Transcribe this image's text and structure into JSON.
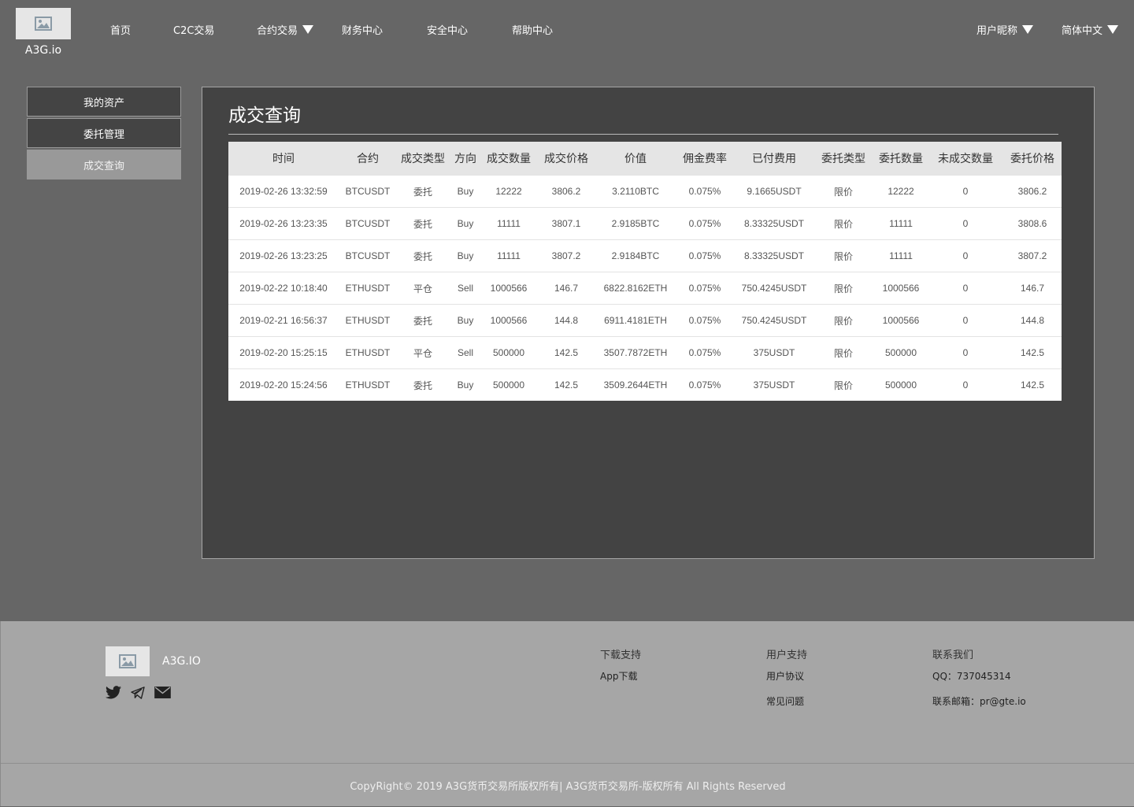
{
  "header": {
    "brand": "A3G.io",
    "nav": [
      "首页",
      "C2C交易",
      "合约交易",
      "财务中心",
      "安全中心",
      "帮助中心"
    ],
    "user_label": "用户昵称",
    "language_label": "简体中文"
  },
  "sidebar": {
    "items": [
      {
        "label": "我的资产"
      },
      {
        "label": "委托管理"
      },
      {
        "label": "成交查询"
      }
    ]
  },
  "main": {
    "title": "成交查询",
    "table": {
      "columns": [
        "时间",
        "合约",
        "成交类型",
        "方向",
        "成交数量",
        "成交价格",
        "价值",
        "佣金费率",
        "已付费用",
        "委托类型",
        "委托数量",
        "未成交数量",
        "委托价格"
      ],
      "rows": [
        [
          "2019-02-26 13:32:59",
          "BTCUSDT",
          "委托",
          "Buy",
          "12222",
          "3806.2",
          "3.2110BTC",
          "0.075%",
          "9.1665USDT",
          "限价",
          "12222",
          "0",
          "3806.2"
        ],
        [
          "2019-02-26 13:23:35",
          "BTCUSDT",
          "委托",
          "Buy",
          "11111",
          "3807.1",
          "2.9185BTC",
          "0.075%",
          "8.33325USDT",
          "限价",
          "11111",
          "0",
          "3808.6"
        ],
        [
          "2019-02-26 13:23:25",
          "BTCUSDT",
          "委托",
          "Buy",
          "11111",
          "3807.2",
          "2.9184BTC",
          "0.075%",
          "8.33325USDT",
          "限价",
          "11111",
          "0",
          "3807.2"
        ],
        [
          "2019-02-22 10:18:40",
          "ETHUSDT",
          "平仓",
          "Sell",
          "1000566",
          "146.7",
          "6822.8162ETH",
          "0.075%",
          "750.4245USDT",
          "限价",
          "1000566",
          "0",
          "146.7"
        ],
        [
          "2019-02-21 16:56:37",
          "ETHUSDT",
          "委托",
          "Buy",
          "1000566",
          "144.8",
          "6911.4181ETH",
          "0.075%",
          "750.4245USDT",
          "限价",
          "1000566",
          "0",
          "144.8"
        ],
        [
          "2019-02-20 15:25:15",
          "ETHUSDT",
          "平仓",
          "Sell",
          "500000",
          "142.5",
          "3507.7872ETH",
          "0.075%",
          "375USDT",
          "限价",
          "500000",
          "0",
          "142.5"
        ],
        [
          "2019-02-20 15:24:56",
          "ETHUSDT",
          "委托",
          "Buy",
          "500000",
          "142.5",
          "3509.2644ETH",
          "0.075%",
          "375USDT",
          "限价",
          "500000",
          "0",
          "142.5"
        ]
      ]
    }
  },
  "footer": {
    "brand": "A3G.IO",
    "columns": [
      {
        "title": "下载支持",
        "links": [
          "App下载"
        ]
      },
      {
        "title": "用户支持",
        "links": [
          "用户协议",
          "常见问题"
        ]
      },
      {
        "title": "联系我们",
        "links": [
          "QQ：737045314",
          "联系邮箱：pr@gte.io"
        ]
      }
    ],
    "copyright": "CopyRight© 2019 A3G货币交易所版权所有| A3G货币交易所-版权所有 All Rights Reserved"
  },
  "icons": [
    "image-placeholder-icon",
    "twitter-icon",
    "telegram-icon",
    "mail-icon",
    "caret-down-icon"
  ]
}
